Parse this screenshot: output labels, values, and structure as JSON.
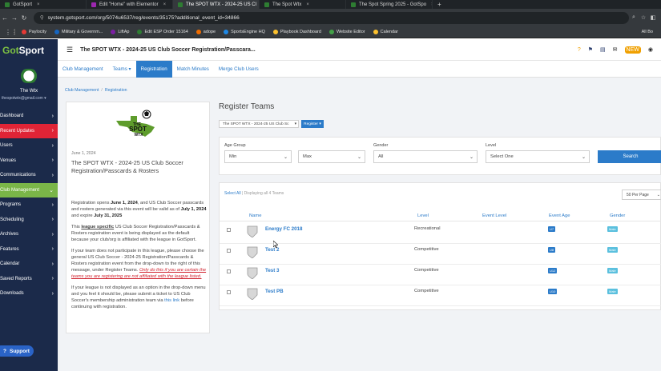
{
  "browser": {
    "tabs": [
      {
        "label": "GotSport",
        "active": false,
        "color": "#2e7d32"
      },
      {
        "label": "Edit \"Home\" with Elementor",
        "active": false,
        "color": "#9c27b0"
      },
      {
        "label": "The SPOT WTX - 2024-25 US Cl",
        "active": true,
        "color": "#2e7d32"
      },
      {
        "label": "The Spot Wtx",
        "active": false,
        "color": "#2e7d32"
      },
      {
        "label": "The Spot Spring 2025 - GotSpo",
        "active": false,
        "color": "#2e7d32"
      }
    ],
    "new_tab": "+",
    "url": "system.gotsport.com/org/5074u6537/reg/events/35175?additional_event_id=34866",
    "bookmarks": [
      {
        "label": "Paylocity",
        "color": "#e53935"
      },
      {
        "label": "Military & Governm...",
        "color": "#1565c0"
      },
      {
        "label": "LiftAp",
        "color": "#7b1fa2"
      },
      {
        "label": "Edit ESP Order 15164",
        "color": "#2e7d32"
      },
      {
        "label": "adope",
        "color": "#ef6c00"
      },
      {
        "label": "SportsEngine HQ",
        "color": "#1e88e5"
      },
      {
        "label": "Playbook Dashboard",
        "color": "#fbc02d"
      },
      {
        "label": "Website Editor",
        "color": "#43a047"
      },
      {
        "label": "Calendar",
        "color": "#fbc02d"
      }
    ],
    "all_bookmarks": "All Bo"
  },
  "sidebar": {
    "logo_left": "Got",
    "logo_right": "Sport",
    "club_name": "The Wtx",
    "club_email": "thespotwtx@gmail.com",
    "items": [
      {
        "label": "Dashboard",
        "state": "normal"
      },
      {
        "label": "Recent Updates",
        "state": "red"
      },
      {
        "label": "Users",
        "state": "normal"
      },
      {
        "label": "Venues",
        "state": "normal"
      },
      {
        "label": "Communications",
        "state": "normal"
      },
      {
        "label": "Club Management",
        "state": "green"
      },
      {
        "label": "Programs",
        "state": "normal"
      },
      {
        "label": "Scheduling",
        "state": "normal"
      },
      {
        "label": "Archives",
        "state": "normal"
      },
      {
        "label": "Features",
        "state": "normal"
      },
      {
        "label": "Calendar",
        "state": "normal"
      },
      {
        "label": "Saved Reports",
        "state": "normal"
      },
      {
        "label": "Downloads",
        "state": "normal"
      }
    ],
    "support_label": "Support"
  },
  "topbar": {
    "title": "The SPOT WTX - 2024-25 US Club Soccer Registration/Passcara...",
    "new_badge": "NEW"
  },
  "subnav": {
    "tabs": [
      {
        "label": "Club Management",
        "active": false
      },
      {
        "label": "Teams",
        "active": false
      },
      {
        "label": "Registration",
        "active": true
      },
      {
        "label": "Match Minutes",
        "active": false
      },
      {
        "label": "Merge Club Users",
        "active": false
      }
    ]
  },
  "breadcrumb": {
    "items": [
      "Club Management",
      "Registration"
    ]
  },
  "event": {
    "logo_line1": "THE",
    "logo_line2": "SPOT",
    "logo_line3": "WTX",
    "date": "June 1, 2024",
    "title": "The SPOT WTX - 2024-25 US Club Soccer Registration/Passcards & Rosters",
    "p1_a": "Registration opens ",
    "p1_open": "June 1, 2024",
    "p1_b": ", and US Club Soccer passcards and rosters generated via this event will be valid as of ",
    "p1_valid": "July 1, 2024",
    "p1_c": " and expire ",
    "p1_expire": "July 31, 2025",
    "p2_a": "This ",
    "p2_specific": "league specific",
    "p2_b": " US Club Soccer Registration/Passcards & Rosters registration event is being displayed as the default because your club/org is affiliated with the league in GotSport.",
    "p3_a": "If your team does not participate in this league, please choose the general US Club Soccer - 2024-25 Registration/Passcards & Rosters registration event from the drop-down to the right of this message, under Register Teams. ",
    "p3_warn": "Only do this if you are certain the teams you are registering are not affiliated with the league listed.",
    "p4_a": "If your league is not displayed as an option in the drop-down menu and you feel it should be, please submit a ticket to US Club Soccer's membership administration team via ",
    "p4_link": "this link",
    "p4_b": " before continuing with registration."
  },
  "register": {
    "heading": "Register Teams",
    "event_select": "The SPOT WTX - 2024-25 US Club Sc",
    "register_btn": "Register"
  },
  "filters": {
    "age_group_label": "Age Group",
    "min_value": "Min",
    "max_value": "Max",
    "gender_label": "Gender",
    "gender_value": "All",
    "level_label": "Level",
    "level_value": "Select One",
    "search_btn": "Search"
  },
  "teams": {
    "select_all": "Select All",
    "displaying": "Displaying all 4 Teams",
    "per_page": "50 Per Page",
    "headers": {
      "name": "Name",
      "level": "Level",
      "event_level": "Event Level",
      "event_age": "Event Age",
      "gender": "Gender"
    },
    "rows": [
      {
        "name": "Energy FC 2018",
        "level": "Recreational",
        "age": "U7",
        "gender": "Male"
      },
      {
        "name": "Test 2",
        "level": "Competitive",
        "age": "U8",
        "gender": "Male"
      },
      {
        "name": "Test 3",
        "level": "Competitive",
        "age": "U12",
        "gender": "Male"
      },
      {
        "name": "Test PB",
        "level": "Competitive",
        "age": "U10",
        "gender": "Male"
      }
    ]
  }
}
